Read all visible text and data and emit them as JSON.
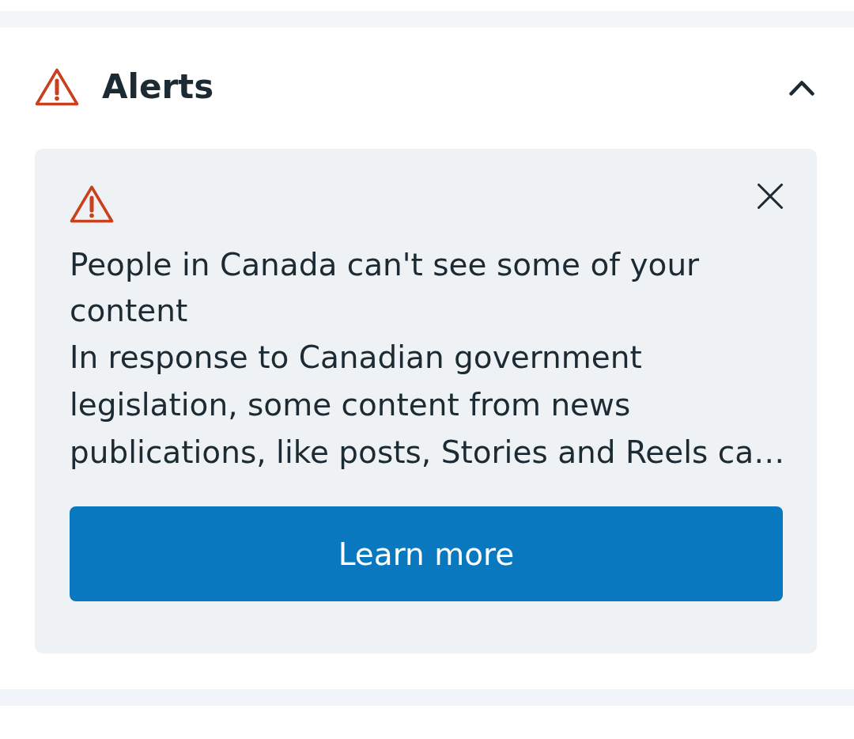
{
  "section": {
    "title": "Alerts",
    "expanded": true
  },
  "alerts": [
    {
      "kind": "warning",
      "title": "People in Canada can't see some of your content",
      "body": "In response to Canadian government legislation, some content from news publications, like posts, Stories and Reels ca…",
      "button": "Learn more",
      "dismissible": true
    }
  ]
}
